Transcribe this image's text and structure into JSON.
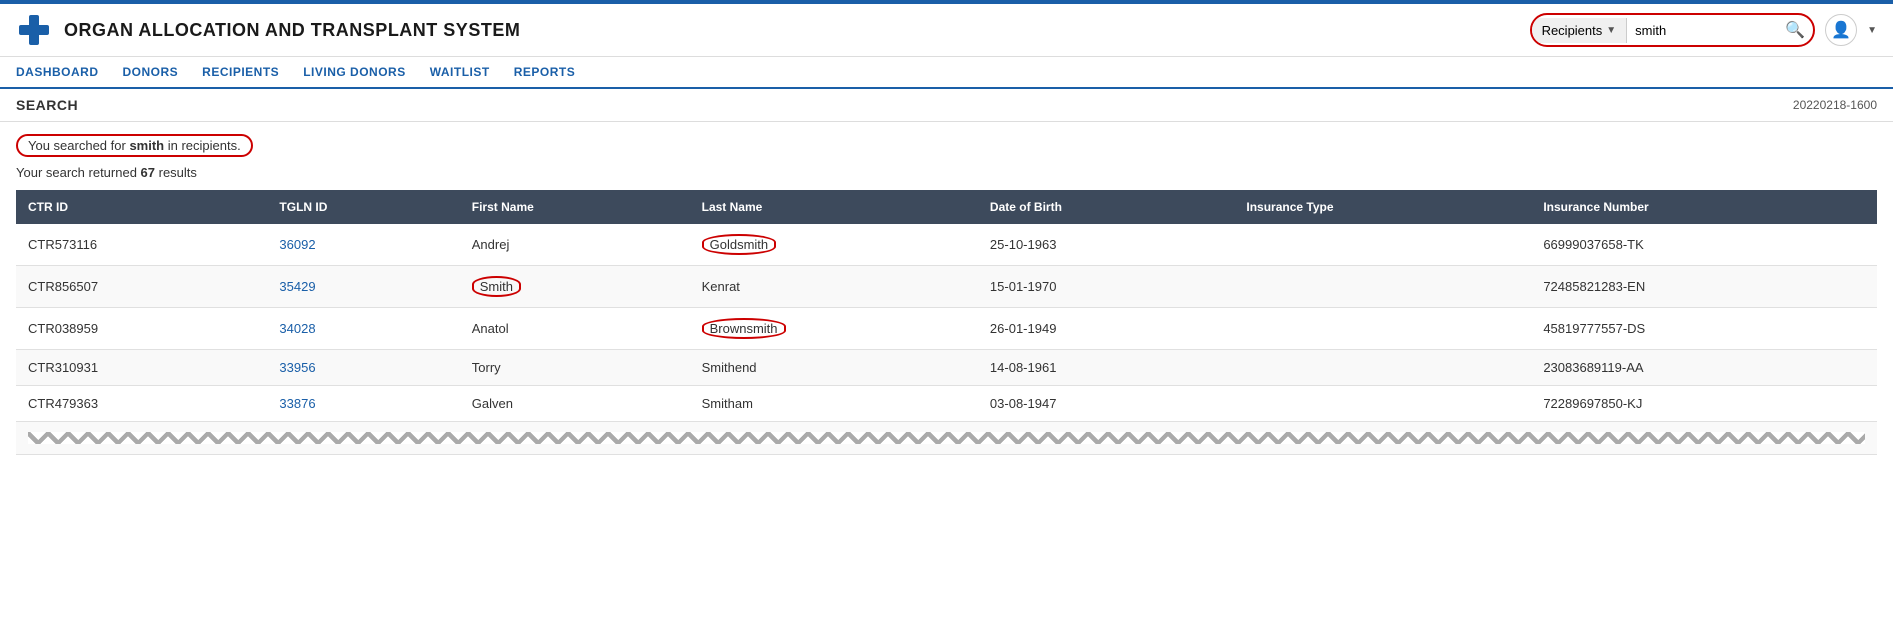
{
  "topbar": {},
  "header": {
    "title": "ORGAN ALLOCATION AND TRANSPLANT SYSTEM",
    "search": {
      "category": "Recipients",
      "query": "smith",
      "placeholder": "search"
    }
  },
  "nav": {
    "items": [
      {
        "label": "DASHBOARD",
        "href": "#"
      },
      {
        "label": "DONORS",
        "href": "#"
      },
      {
        "label": "RECIPIENTS",
        "href": "#"
      },
      {
        "label": "LIVING DONORS",
        "href": "#"
      },
      {
        "label": "WAITLIST",
        "href": "#"
      },
      {
        "label": "REPORTS",
        "href": "#"
      }
    ]
  },
  "page": {
    "title": "SEARCH",
    "timestamp": "20220218-1600"
  },
  "search_result": {
    "query": "smith",
    "context": "recipients",
    "full_text_pre": "You searched for ",
    "full_text_mid": "smith",
    "full_text_post": " in recipients.",
    "count_text": "Your search returned ",
    "count": "67",
    "count_suffix": " results"
  },
  "table": {
    "columns": [
      {
        "label": "CTR ID",
        "key": "ctr_id"
      },
      {
        "label": "TGLN ID",
        "key": "tgln_id"
      },
      {
        "label": "First Name",
        "key": "first_name"
      },
      {
        "label": "Last Name",
        "key": "last_name"
      },
      {
        "label": "Date of Birth",
        "key": "dob"
      },
      {
        "label": "Insurance Type",
        "key": "insurance_type"
      },
      {
        "label": "Insurance Number",
        "key": "insurance_number"
      }
    ],
    "rows": [
      {
        "ctr_id": "CTR573116",
        "tgln_id": "36092",
        "first_name": "Andrej",
        "last_name": "Goldsmith",
        "last_name_circled": true,
        "first_name_circled": false,
        "dob": "25-10-1963",
        "insurance_type": "",
        "insurance_number": "66999037658-TK"
      },
      {
        "ctr_id": "CTR856507",
        "tgln_id": "35429",
        "first_name": "Smith",
        "last_name": "Kenrat",
        "last_name_circled": false,
        "first_name_circled": true,
        "dob": "15-01-1970",
        "insurance_type": "",
        "insurance_number": "72485821283-EN"
      },
      {
        "ctr_id": "CTR038959",
        "tgln_id": "34028",
        "first_name": "Anatol",
        "last_name": "Brownsmith",
        "last_name_circled": true,
        "first_name_circled": false,
        "dob": "26-01-1949",
        "insurance_type": "",
        "insurance_number": "45819777557-DS"
      },
      {
        "ctr_id": "CTR310931",
        "tgln_id": "33956",
        "first_name": "Torry",
        "last_name": "Smithend",
        "last_name_circled": false,
        "first_name_circled": false,
        "dob": "14-08-1961",
        "insurance_type": "",
        "insurance_number": "23083689119-AA"
      },
      {
        "ctr_id": "CTR479363",
        "tgln_id": "33876",
        "first_name": "Galven",
        "last_name": "Smitham",
        "last_name_circled": false,
        "first_name_circled": false,
        "dob": "03-08-1947",
        "insurance_type": "",
        "insurance_number": "72289697850-KJ"
      }
    ]
  }
}
